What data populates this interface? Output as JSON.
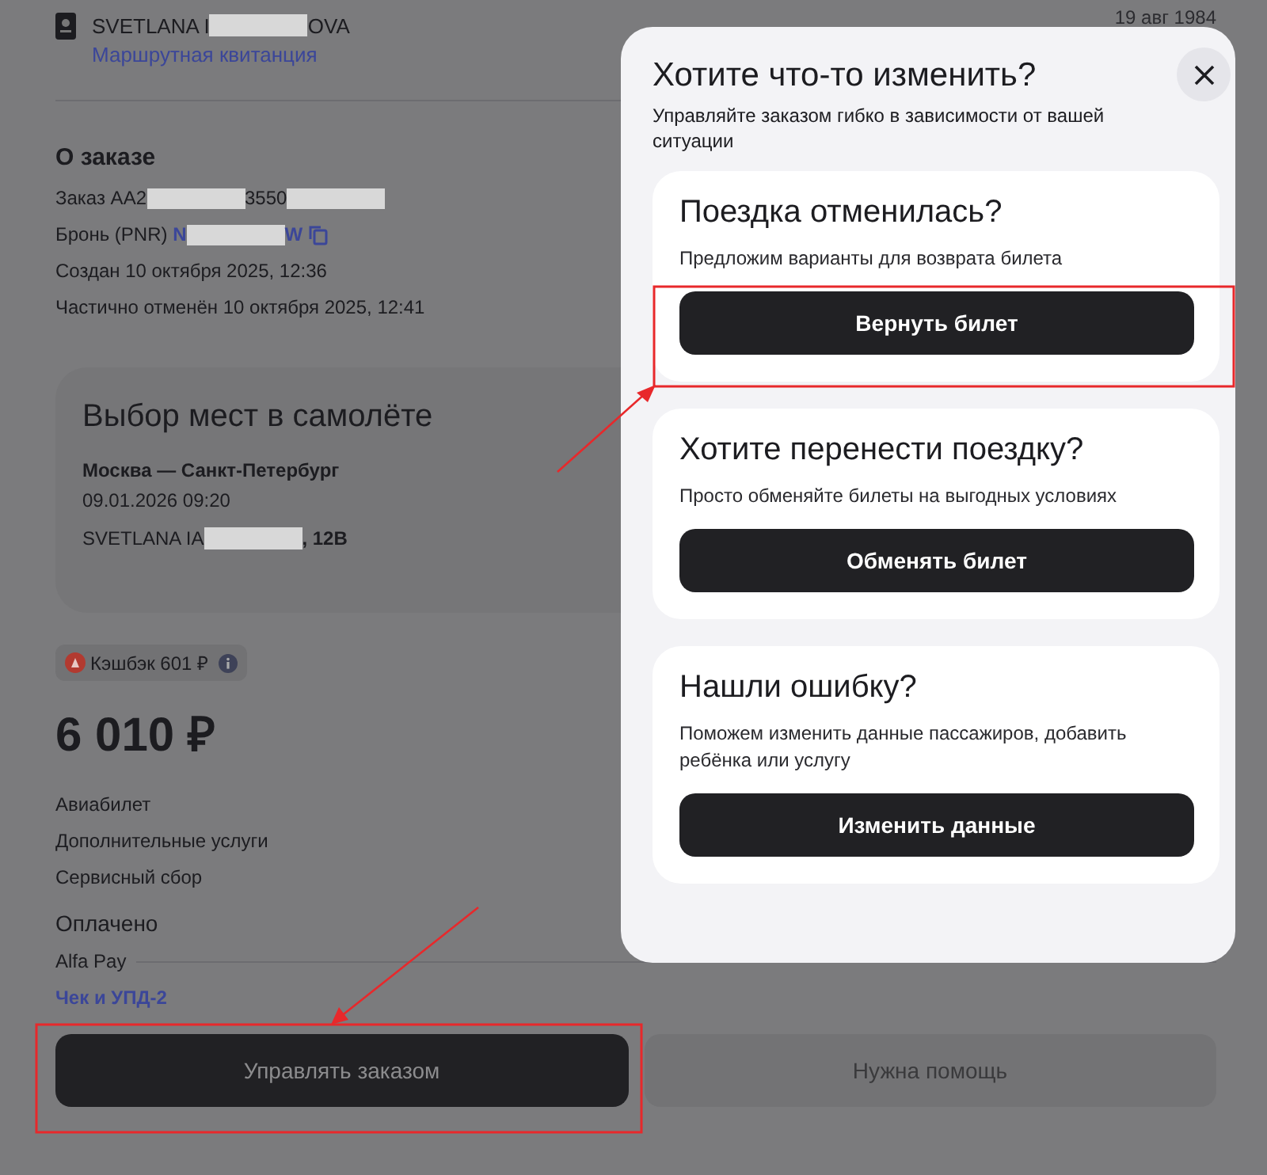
{
  "passenger": {
    "name": [
      {
        "kind": "plain",
        "text": "SVETLANA I"
      },
      {
        "kind": "redacted"
      },
      {
        "kind": "plain",
        "text": "OVA"
      }
    ],
    "ticket_link": "Маршрутная квитанция",
    "birth_date": "19 авг 1984"
  },
  "order": {
    "title": "О заказе",
    "lines": [
      {
        "kind": "order",
        "segments": [
          {
            "kind": "plain",
            "text": "Заказ AA2"
          },
          {
            "kind": "redacted"
          },
          {
            "kind": "plain",
            "text": "3550"
          },
          {
            "kind": "redacted"
          }
        ]
      },
      {
        "kind": "booking",
        "segments": [
          {
            "kind": "plain",
            "text": "Бронь (PNR)"
          },
          {
            "kind": "link",
            "text": "N"
          },
          {
            "kind": "redacted"
          },
          {
            "kind": "link",
            "text": "W"
          }
        ]
      },
      {
        "kind": "plain",
        "segments": [
          {
            "kind": "plain",
            "text": "Создан 10 октября 2025, 12:36"
          }
        ]
      },
      {
        "kind": "plain",
        "segments": [
          {
            "kind": "plain",
            "text": "Частично отменён 10 октября 2025, 12:41"
          }
        ]
      }
    ]
  },
  "seat_card": {
    "title": "Выбор мест в самолёте",
    "route": "Москва — Санкт-Петербург",
    "datetime": "09.01.2026 09:20",
    "passenger": [
      {
        "kind": "plain",
        "text": "SVETLANA IA"
      },
      {
        "kind": "redacted"
      },
      {
        "kind": "bold",
        "text": ", 12B"
      }
    ]
  },
  "cashback": "Кэшбэк 601 ₽",
  "price": "6 010 ₽",
  "breakdown": [
    "Авиабилет",
    "Дополнительные услуги",
    "Сервисный сбор"
  ],
  "payment": {
    "title": "Оплачено",
    "method": "Alfa Pay",
    "receipt_link": "Чек и УПД-2"
  },
  "actions": [
    {
      "kind": "primary",
      "label": "Управлять заказом"
    },
    {
      "kind": "secondary",
      "label": "Нужна помощь"
    }
  ],
  "modal": {
    "title": "Хотите что-то изменить?",
    "subtitle": "Управляйте заказом гибко в зависимости от вашей ситуации",
    "cards": [
      {
        "title": "Поездка отменилась?",
        "description": "Предложим варианты для возврата билета",
        "button": "Вернуть билет"
      },
      {
        "title": "Хотите перенести поездку?",
        "description": "Просто обменяйте билеты на выгодных условиях",
        "button": "Обменять билет"
      },
      {
        "title": "Нашли ошибку?",
        "description": "Поможем изменить данные пассажиров, добавить ребёнка или услугу",
        "button": "Изменить данные"
      }
    ]
  }
}
